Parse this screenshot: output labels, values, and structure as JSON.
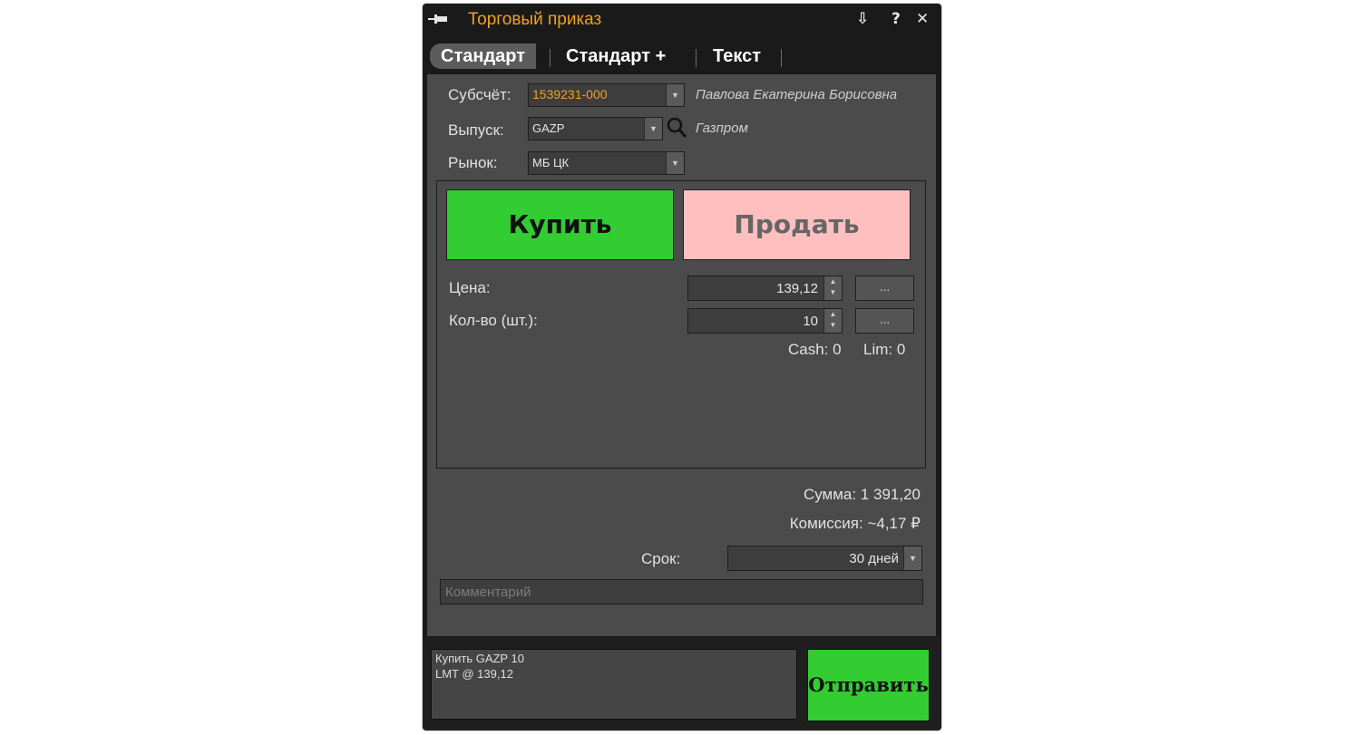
{
  "window": {
    "title": "Торговый приказ",
    "title_color": "#f0a020",
    "controls": {
      "dock": "⇩",
      "help": "?",
      "close": "✕"
    }
  },
  "tabs": [
    {
      "label": "Стандарт",
      "active": true
    },
    {
      "label": "Стандарт +",
      "active": false
    },
    {
      "label": "Текст",
      "active": false
    }
  ],
  "form": {
    "subaccount": {
      "label": "Субсчёт:",
      "value": "1539231-000",
      "owner": "Павлова Екатерина Борисовна"
    },
    "issue": {
      "label": "Выпуск:",
      "value": "GAZP",
      "name": "Газпром"
    },
    "market": {
      "label": "Рынок:",
      "value": "МБ ЦК"
    }
  },
  "order": {
    "buy_label": "Купить",
    "sell_label": "Продать",
    "buy_color": "#33cc33",
    "sell_color": "#ffbfbf",
    "price": {
      "label": "Цена:",
      "value": "139,12",
      "more": "..."
    },
    "quantity": {
      "label": "Кол-во (шт.):",
      "value": "10",
      "more": "..."
    },
    "cash": "Cash: 0",
    "lim": "Lim: 0"
  },
  "summary": {
    "total": "Сумма: 1 391,20",
    "commission": "Комиссия: ~4,17 ₽"
  },
  "term": {
    "label": "Срок:",
    "value": "30 дней"
  },
  "comment": {
    "placeholder": "Комментарий",
    "value": ""
  },
  "preview": {
    "line1": "Купить GAZP 10",
    "line2": "LMT @ 139,12"
  },
  "send_label": "Отправить"
}
